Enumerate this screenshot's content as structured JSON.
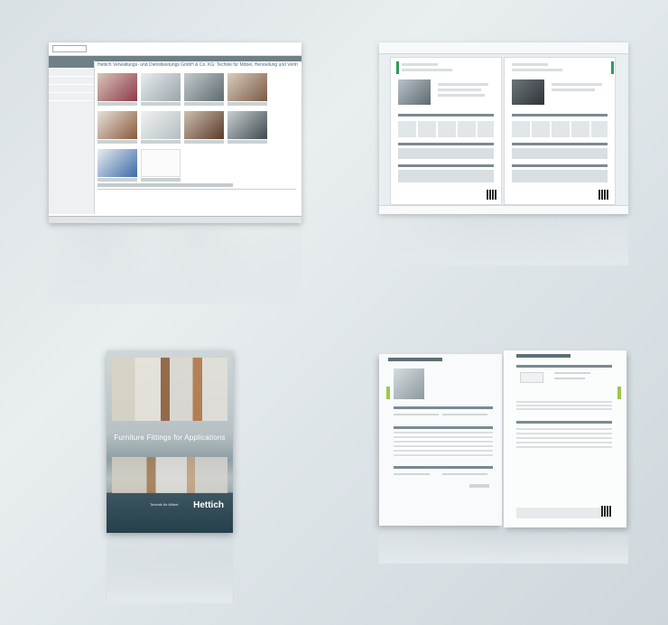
{
  "website": {
    "heading": "Hettich Verwaltungs- und Dienstleistungs GmbH & Co. KG: Technik für Möbel, Herstellung und Vertrieb"
  },
  "brochure": {
    "title": "Furniture Fittings for Applications",
    "tagline": "Technik für Möbel",
    "brand": "Hettich"
  },
  "colors": {
    "accent_green": "#2f9a5a",
    "tab_green": "#9dc84b",
    "nav_gray": "#6f8086",
    "cover_blue": "#24404c"
  }
}
